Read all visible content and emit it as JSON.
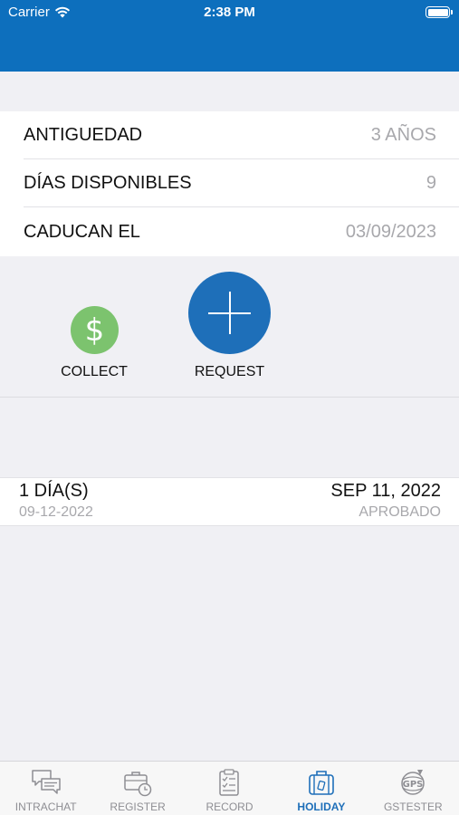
{
  "status_bar": {
    "carrier": "Carrier",
    "time": "2:38 PM"
  },
  "info": [
    {
      "label": "ANTIGUEDAD",
      "value": "3 AÑOS"
    },
    {
      "label": "DÍAS DISPONIBLES",
      "value": "9"
    },
    {
      "label": "CADUCAN EL",
      "value": "03/09/2023"
    }
  ],
  "actions": {
    "collect_label": "COLLECT",
    "collect_symbol": "$",
    "request_label": "REQUEST"
  },
  "requests": [
    {
      "days": "1 DÍA(S)",
      "date": "SEP 11, 2022",
      "requested_on": "09-12-2022",
      "status": "APROBADO"
    }
  ],
  "tabs": [
    {
      "label": "INTRACHAT",
      "icon": "chat-icon"
    },
    {
      "label": "REGISTER",
      "icon": "briefcase-clock-icon"
    },
    {
      "label": "RECORD",
      "icon": "clipboard-checklist-icon"
    },
    {
      "label": "HOLIDAY",
      "icon": "luggage-icon",
      "active": true
    },
    {
      "label": "GSTESTER",
      "icon": "gps-logo-icon"
    }
  ],
  "colors": {
    "header": "#0d6fbd",
    "accent": "#1e6fb9",
    "collect": "#7cc36e"
  }
}
